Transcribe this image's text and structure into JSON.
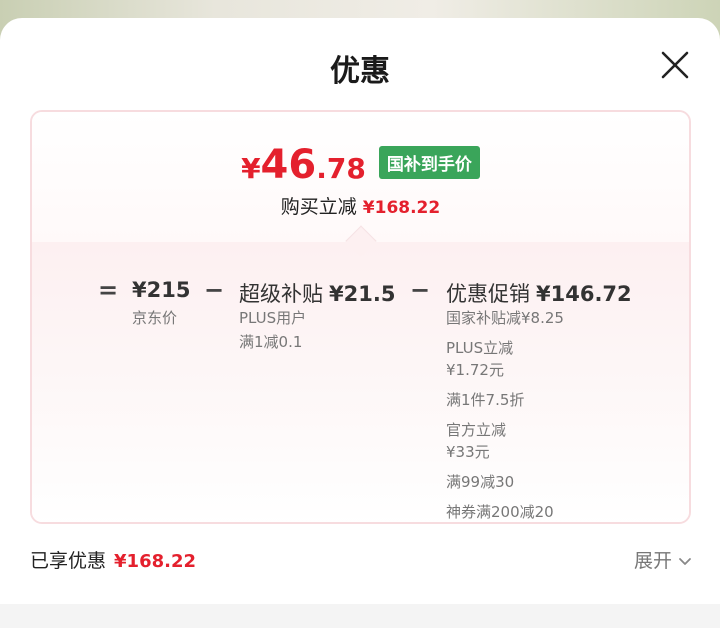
{
  "header": {
    "title": "优惠"
  },
  "summary": {
    "price_yen": "¥",
    "price_int": "46",
    "price_dec": ".78",
    "badge": "国补到手价",
    "discount_label": "购买立减",
    "discount_amount": "¥168.22"
  },
  "breakdown": {
    "eq": "=",
    "minus": "−",
    "jd_price": {
      "value": "¥215",
      "label": "京东价"
    },
    "subsidy": {
      "title": "超级补贴",
      "value": "¥21.5",
      "details": [
        "PLUS用户",
        "满1减0.1"
      ]
    },
    "promo": {
      "title": "优惠促销",
      "value": "¥146.72",
      "details": [
        "国家补贴减¥8.25",
        "PLUS立减",
        "¥1.72元",
        "满1件7.5折",
        "官方立减",
        "¥33元",
        "满99减30",
        "神券满200减20"
      ]
    }
  },
  "footer": {
    "label": "已享优惠",
    "amount": "¥168.22",
    "expand": "展开"
  },
  "colors": {
    "accent_red": "#e4202d",
    "badge_green": "#3aa55a"
  },
  "icons": {
    "close": "close-icon",
    "expand": "chevron-down-icon"
  }
}
